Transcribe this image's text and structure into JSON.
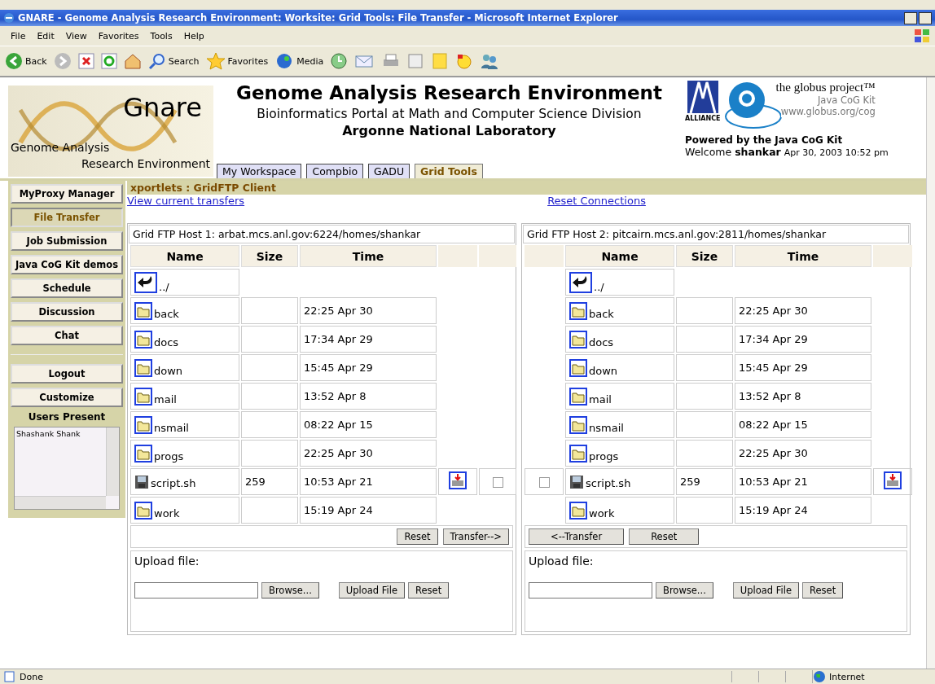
{
  "window": {
    "title": "GNARE - Genome Analysis Research Environment: Worksite: Grid Tools: File Transfer - Microsoft Internet Explorer"
  },
  "menu_bar": [
    "File",
    "Edit",
    "View",
    "Favorites",
    "Tools",
    "Help"
  ],
  "toolbar": {
    "back": "Back",
    "search": "Search",
    "favorites": "Favorites",
    "media": "Media"
  },
  "header": {
    "logo_title": "Gnare",
    "logo_line_1": "Genome Analysis",
    "logo_line_2": "Research Environment",
    "title": "Genome Analysis Research Environment",
    "subtitle": "Bioinformatics Portal at Math and Computer Science Division",
    "institution": "Argonne National Laboratory",
    "tabs": [
      {
        "label": "My Workspace",
        "selected": false
      },
      {
        "label": "Compbio",
        "selected": false
      },
      {
        "label": "GADU",
        "selected": false
      },
      {
        "label": "Grid Tools",
        "selected": true
      }
    ],
    "alliance": "ALLIANCE",
    "globus": "the globus project™",
    "cog": "Java CoG Kit",
    "cog_url": "www.globus.org/cog",
    "powered": "Powered by the Java CoG Kit",
    "welcome": "Welcome",
    "user": "shankar",
    "date": "Apr 30, 2003 10:52 pm"
  },
  "sidebar": {
    "items": [
      {
        "label": "MyProxy Manager",
        "selected": false
      },
      {
        "label": "File Transfer",
        "selected": true
      },
      {
        "label": "Job Submission",
        "selected": false
      },
      {
        "label": "Java CoG Kit demos",
        "selected": false
      },
      {
        "label": "Schedule",
        "selected": false
      },
      {
        "label": "Discussion",
        "selected": false
      },
      {
        "label": "Chat",
        "selected": false
      }
    ],
    "account_items": [
      {
        "label": "Logout",
        "selected": false
      },
      {
        "label": "Customize",
        "selected": false
      }
    ],
    "users_title": "Users Present",
    "users": [
      "Shashank Shank"
    ]
  },
  "portlet": {
    "title": "xportlets : GridFTP Client",
    "link_transfers": "View current transfers",
    "link_reset": "Reset Connections",
    "panels": [
      {
        "kind": "source",
        "host": "Grid FTP Host 1: arbat.mcs.anl.gov:6224/homes/shankar",
        "columns": [
          "Name",
          "Size",
          "Time"
        ],
        "rows": [
          {
            "kind": "parent",
            "name": "../"
          },
          {
            "kind": "folder",
            "name": "back",
            "time": "22:25 Apr 30"
          },
          {
            "kind": "folder",
            "name": "docs",
            "time": "17:34 Apr 29"
          },
          {
            "kind": "folder",
            "name": "down",
            "time": "15:45 Apr 29"
          },
          {
            "kind": "folder",
            "name": "mail",
            "time": "13:52 Apr 8"
          },
          {
            "kind": "folder",
            "name": "nsmail",
            "time": "08:22 Apr 15"
          },
          {
            "kind": "folder",
            "name": "progs",
            "time": "22:25 Apr 30"
          },
          {
            "kind": "file",
            "name": "script.sh",
            "size": "259",
            "time": "10:53 Apr 21",
            "checked": false
          },
          {
            "kind": "folder",
            "name": "work",
            "time": "15:19 Apr 24"
          }
        ],
        "buttons": [
          "Reset",
          "Transfer-->"
        ],
        "upload_label": "Upload file:",
        "browse": "Browse...",
        "upload": "Upload File",
        "reset": "Reset"
      },
      {
        "kind": "destination",
        "host": "Grid FTP Host 2: pitcairn.mcs.anl.gov:2811/homes/shankar",
        "columns": [
          "Name",
          "Size",
          "Time"
        ],
        "rows": [
          {
            "kind": "parent",
            "name": "../"
          },
          {
            "kind": "folder",
            "name": "back",
            "time": "22:25 Apr 30"
          },
          {
            "kind": "folder",
            "name": "docs",
            "time": "17:34 Apr 29"
          },
          {
            "kind": "folder",
            "name": "down",
            "time": "15:45 Apr 29"
          },
          {
            "kind": "folder",
            "name": "mail",
            "time": "13:52 Apr 8"
          },
          {
            "kind": "folder",
            "name": "nsmail",
            "time": "08:22 Apr 15"
          },
          {
            "kind": "folder",
            "name": "progs",
            "time": "22:25 Apr 30"
          },
          {
            "kind": "file",
            "name": "script.sh",
            "size": "259",
            "time": "10:53 Apr 21",
            "checked": false
          },
          {
            "kind": "folder",
            "name": "work",
            "time": "15:19 Apr 24"
          }
        ],
        "buttons": [
          "<--Transfer",
          "Reset"
        ],
        "upload_label": "Upload file:",
        "browse": "Browse...",
        "upload": "Upload File",
        "reset": "Reset"
      }
    ]
  },
  "status_bar": {
    "text": "Done",
    "zone": "Internet"
  }
}
